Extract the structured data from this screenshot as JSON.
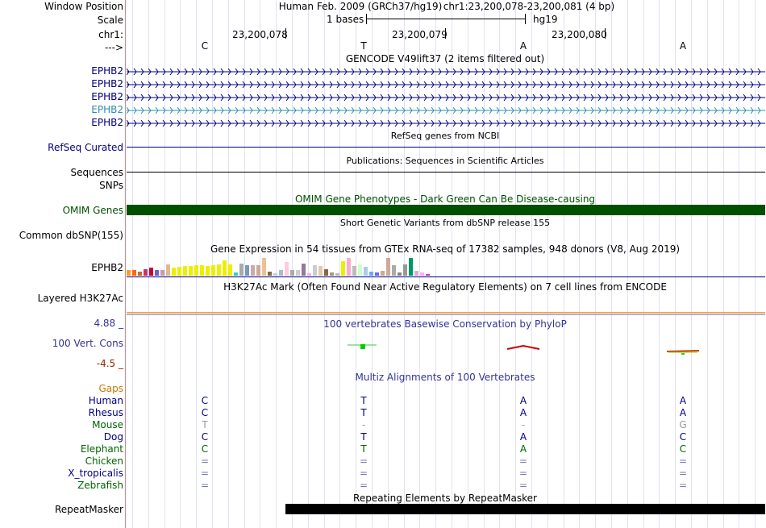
{
  "header": {
    "window_position_label": "Window Position",
    "assembly_text": "Human Feb. 2009 (GRCh37/hg19)",
    "position_text": "chr1:23,200,078-23,200,081 (4 bp)",
    "scale_label": "Scale",
    "scale_text": "1 bases",
    "scale_db": "hg19",
    "chrom_label": "chr1:",
    "coord_ticks": [
      "23,200,078",
      "23,200,079",
      "23,200,080"
    ],
    "strand_label": "--->",
    "bases": [
      "C",
      "T",
      "A",
      "A"
    ]
  },
  "tracks": {
    "gencode": {
      "title": "GENCODE V49lift37 (2 items filtered out)",
      "items": [
        "EPHB2",
        "EPHB2",
        "EPHB2",
        "EPHB2",
        "EPHB2"
      ]
    },
    "refseq": {
      "title": "RefSeq genes from NCBI",
      "label": "RefSeq Curated"
    },
    "publications": {
      "title": "Publications: Sequences in Scientific Articles",
      "label": "Sequences"
    },
    "snps_label": "SNPs",
    "omim": {
      "title": "OMIM Gene Phenotypes - Dark Green Can Be Disease-causing",
      "label": "OMIM Genes"
    },
    "dbsnp": {
      "title": "Short Genetic Variants from dbSNP release 155",
      "label": "Common dbSNP(155)"
    },
    "gtex": {
      "title": "Gene Expression in 54 tissues from GTEx RNA-seq of 17382 samples, 948 donors (V8, Aug 2019)",
      "label": "EPHB2",
      "bars": [
        {
          "v": 0.32,
          "c": "#ff9933"
        },
        {
          "v": 0.3,
          "c": "#ff6600"
        },
        {
          "v": 0.22,
          "c": "#cc6633"
        },
        {
          "v": 0.36,
          "c": "#cc3366"
        },
        {
          "v": 0.44,
          "c": "#cc0033"
        },
        {
          "v": 0.3,
          "c": "#6666cc"
        },
        {
          "v": 0.3,
          "c": "#cc99aa"
        },
        {
          "v": 0.62,
          "c": "#e0b890"
        },
        {
          "v": 0.46,
          "c": "#eeee00"
        },
        {
          "v": 0.5,
          "c": "#eeee00"
        },
        {
          "v": 0.56,
          "c": "#eeee00"
        },
        {
          "v": 0.56,
          "c": "#eeee00"
        },
        {
          "v": 0.58,
          "c": "#eeee00"
        },
        {
          "v": 0.58,
          "c": "#eeee00"
        },
        {
          "v": 0.54,
          "c": "#eeee00"
        },
        {
          "v": 0.58,
          "c": "#eeee00"
        },
        {
          "v": 0.62,
          "c": "#eeee00"
        },
        {
          "v": 0.88,
          "c": "#eeee00"
        },
        {
          "v": 0.62,
          "c": "#eeee00"
        },
        {
          "v": 0.2,
          "c": "#33cccc"
        },
        {
          "v": 0.68,
          "c": "#aaaaaa"
        },
        {
          "v": 0.6,
          "c": "#7799bb"
        },
        {
          "v": 0.6,
          "c": "#ccaaaa"
        },
        {
          "v": 0.6,
          "c": "#ccaa99"
        },
        {
          "v": 1.0,
          "c": "#eec090"
        },
        {
          "v": 0.22,
          "c": "#886644"
        },
        {
          "v": 0.14,
          "c": "#cccccc"
        },
        {
          "v": 0.32,
          "c": "#aabbcc"
        },
        {
          "v": 0.76,
          "c": "#ffccdd"
        },
        {
          "v": 0.34,
          "c": "#aaaaaa"
        },
        {
          "v": 0.34,
          "c": "#cccccc"
        },
        {
          "v": 0.66,
          "c": "#997799"
        },
        {
          "v": 0.12,
          "c": "#ffaaee"
        },
        {
          "v": 0.58,
          "c": "#cccccc"
        },
        {
          "v": 0.56,
          "c": "#ddccaa"
        },
        {
          "v": 0.38,
          "c": "#886644"
        },
        {
          "v": 0.2,
          "c": "#aa9977"
        },
        {
          "v": 0.12,
          "c": "#bbbbbb"
        },
        {
          "v": 0.84,
          "c": "#eeee00"
        },
        {
          "v": 1.0,
          "c": "#ffaacc"
        },
        {
          "v": 0.56,
          "c": "#bbbbbb"
        },
        {
          "v": 0.62,
          "c": "#ccffcc"
        },
        {
          "v": 0.52,
          "c": "#aaccee"
        },
        {
          "v": 0.22,
          "c": "#66aaff"
        },
        {
          "v": 0.18,
          "c": "#6666ff"
        },
        {
          "v": 0.28,
          "c": "#ccaa88"
        },
        {
          "v": 1.0,
          "c": "#ccaa99"
        },
        {
          "v": 0.6,
          "c": "#aaaaaa"
        },
        {
          "v": 0.2,
          "c": "#888888"
        },
        {
          "v": 0.62,
          "c": "#999999"
        },
        {
          "v": 1.0,
          "c": "#009966"
        },
        {
          "v": 0.28,
          "c": "#ddaadd"
        },
        {
          "v": 0.16,
          "c": "#ffaaff"
        },
        {
          "v": 0.1,
          "c": "#cc33cc"
        }
      ]
    },
    "h3k27ac": {
      "title": "H3K27Ac Mark (Often Found Near Active Regulatory Elements) on 7 cell lines from ENCODE",
      "label": "Layered H3K27Ac"
    },
    "cons": {
      "title": "100 vertebrates Basewise Conservation by PhyloP",
      "label": "100 Vert. Cons",
      "max": "4.88 _",
      "min": "-4.5 _"
    },
    "multiz": {
      "title": "Multiz Alignments of 100 Vertebrates",
      "gaps_label": "Gaps",
      "species": [
        {
          "name": "Human",
          "bases": [
            "C",
            "T",
            "A",
            "A"
          ],
          "color": "#000080",
          "base_color": "#000080"
        },
        {
          "name": "Rhesus",
          "bases": [
            "C",
            "T",
            "A",
            "A"
          ],
          "color": "#000080",
          "base_color": "#000080"
        },
        {
          "name": "Mouse",
          "bases": [
            "T",
            "-",
            "-",
            "G"
          ],
          "color": "#006400",
          "base_color": "#999999"
        },
        {
          "name": "Dog",
          "bases": [
            "C",
            "T",
            "A",
            "C"
          ],
          "color": "#000080",
          "base_color": "#000080"
        },
        {
          "name": "Elephant",
          "bases": [
            "C",
            "T",
            "A",
            "C"
          ],
          "color": "#006400",
          "base_color": "#006400"
        },
        {
          "name": "Chicken",
          "bases": [
            "=",
            "=",
            "=",
            "="
          ],
          "color": "#006400",
          "base_color": "#7777aa"
        },
        {
          "name": "X_tropicalis",
          "bases": [
            "=",
            "=",
            "=",
            "="
          ],
          "color": "#000080",
          "base_color": "#7777aa"
        },
        {
          "name": "Zebrafish",
          "bases": [
            "=",
            "=",
            "=",
            "="
          ],
          "color": "#006400",
          "base_color": "#7777aa"
        }
      ]
    },
    "repeatmasker": {
      "title": "Repeating Elements by RepeatMasker",
      "label": "RepeatMasker"
    }
  },
  "colors": {
    "navy": "#000080",
    "omim_green": "#005000",
    "gaps_orange": "#cc7700",
    "cons_blue": "#333399",
    "cons_min_red": "#992200",
    "gencode_highlight": "#2f8fb0"
  }
}
